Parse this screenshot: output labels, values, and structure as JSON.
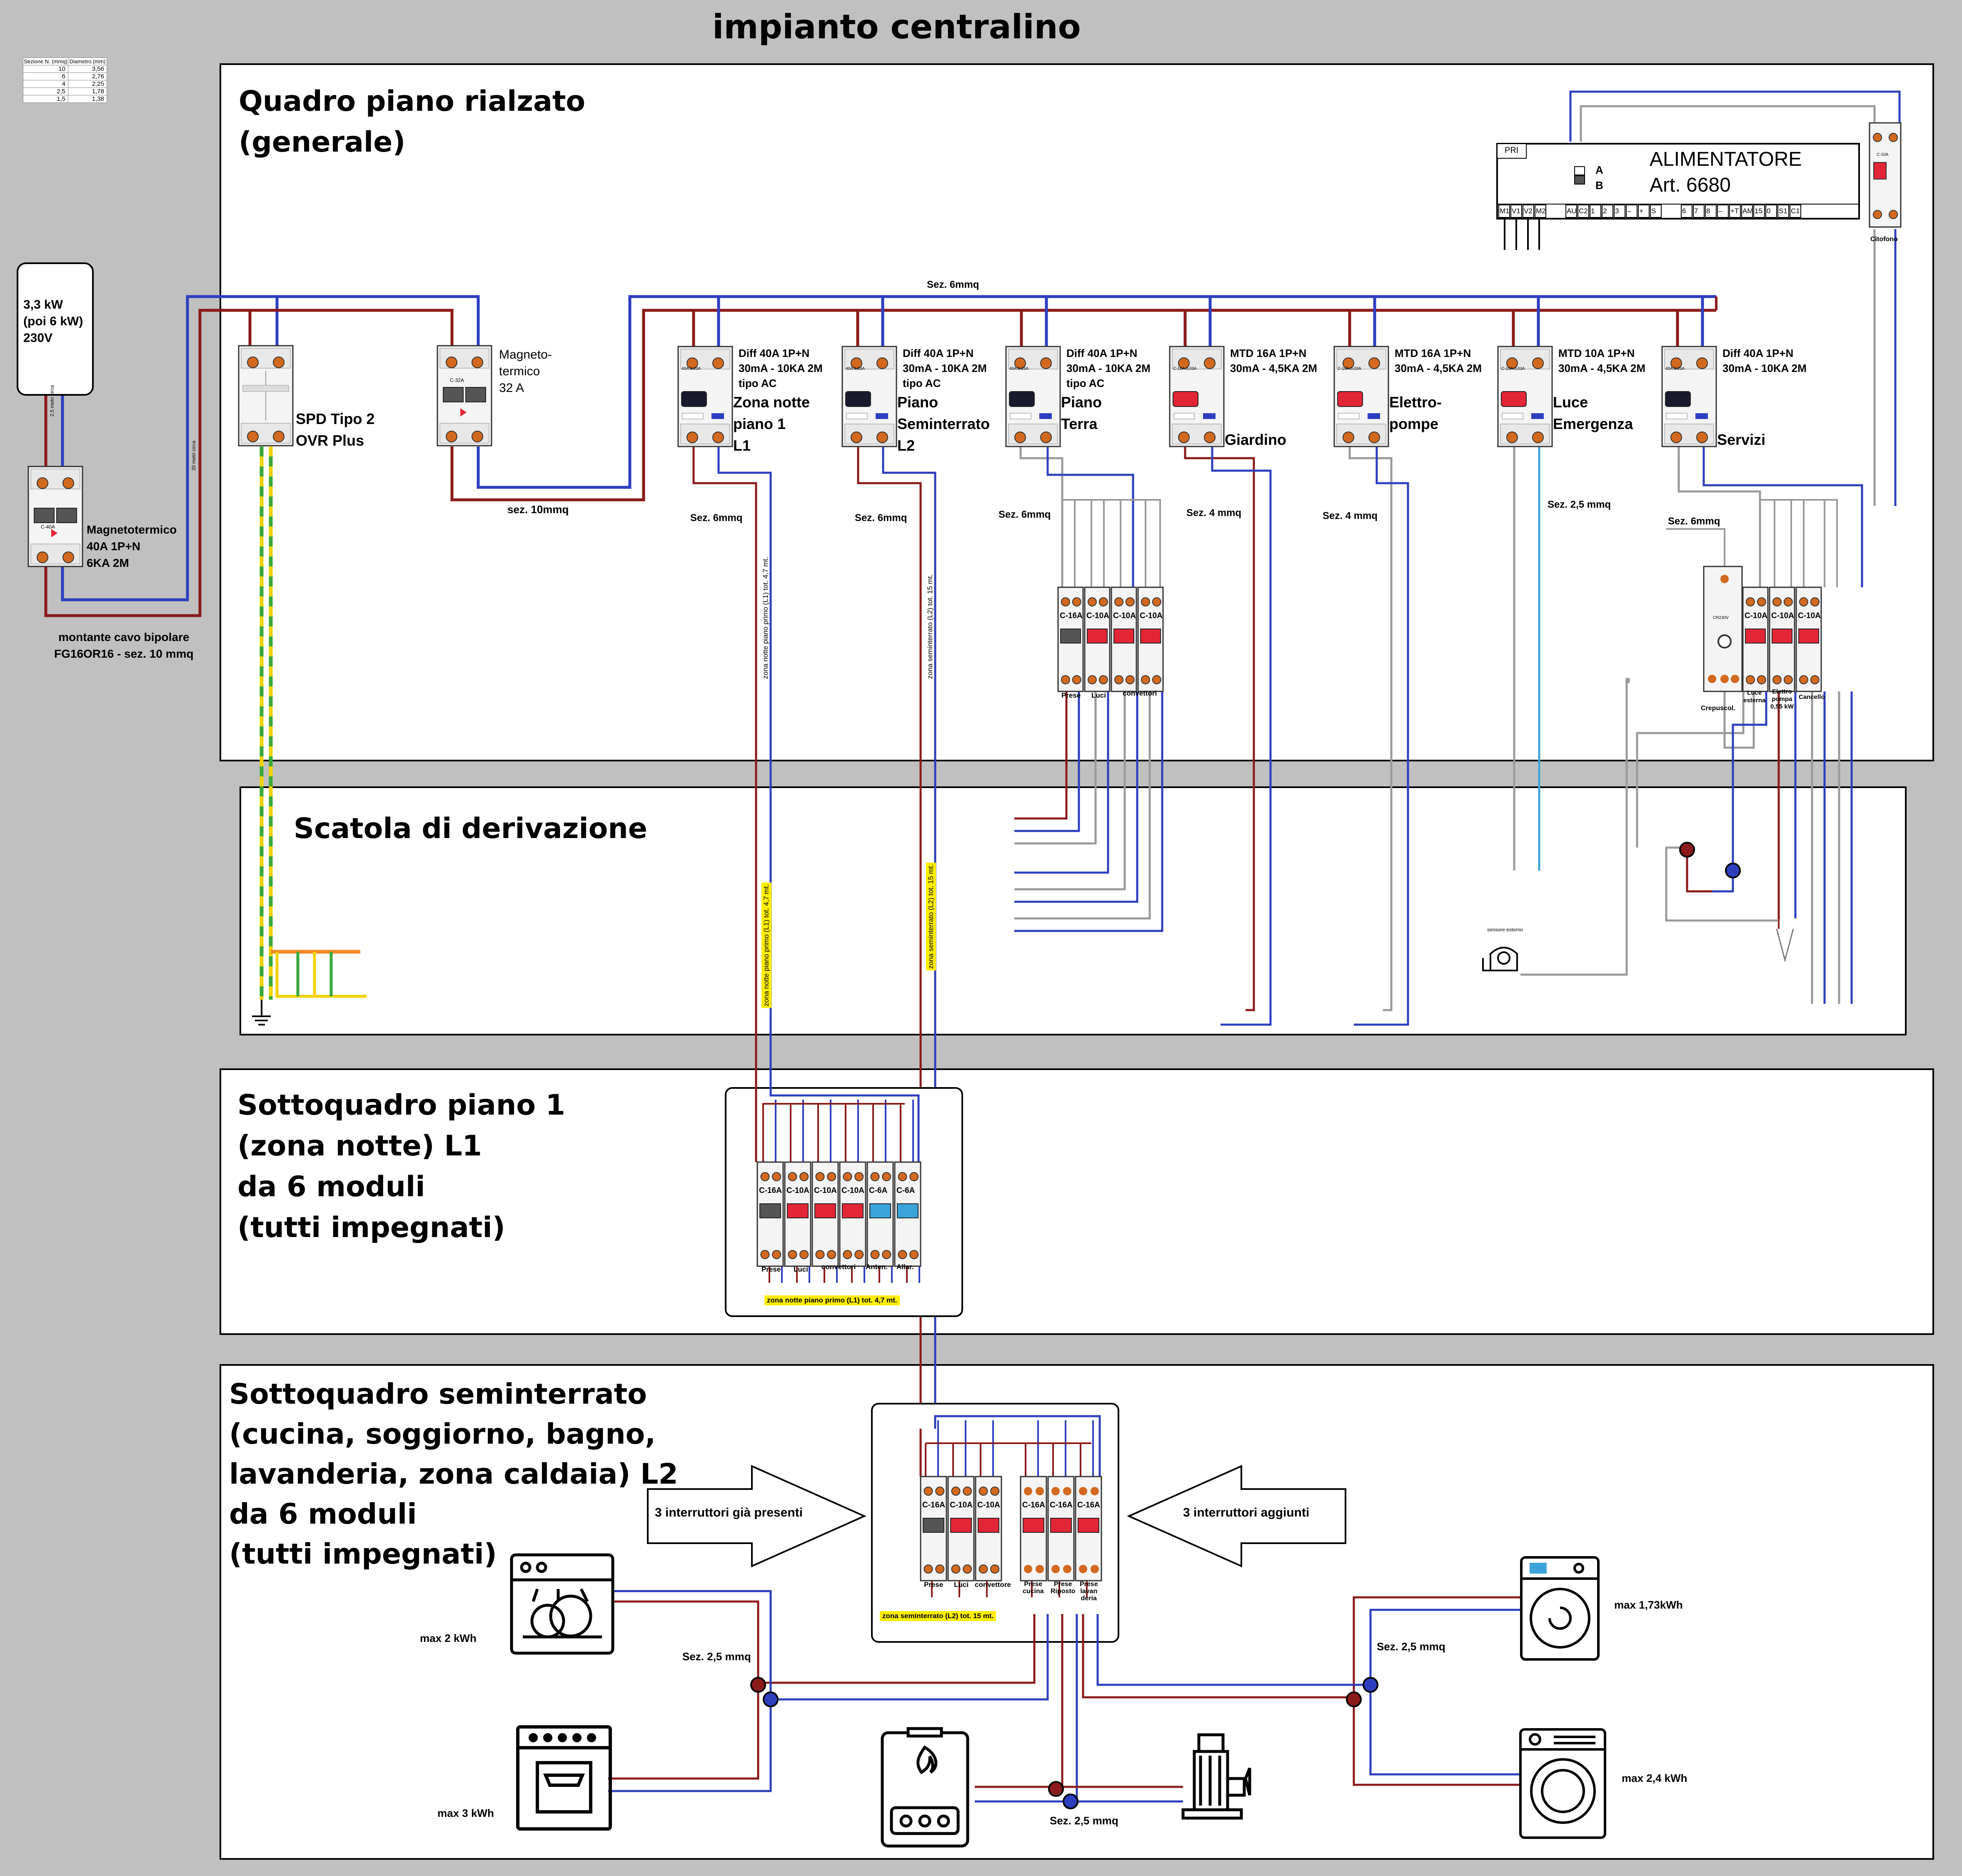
{
  "page_title": "impianto centralino",
  "sections": {
    "quadro": "Quadro piano rialzato\n(generale)",
    "scatola": "Scatola di derivazione",
    "sotto1": "Sottoquadro piano 1\n(zona notte) L1\nda 6 moduli\n(tutti impegnati)",
    "sotto2": "Sottoquadro seminterrato\n(cucina, soggiorno, bagno,\nlavanderia, zona caldaia) L2\nda 6 moduli\n(tutti impegnati)"
  },
  "wire_table": {
    "headers": [
      "Sezione N. (mmq)",
      "Diametro (mm)"
    ],
    "rows": [
      [
        "10",
        "3,56"
      ],
      [
        "6",
        "2,76"
      ],
      [
        "4",
        "2,25"
      ],
      [
        "2,5",
        "1,78"
      ],
      [
        "1,5",
        "1,38"
      ]
    ]
  },
  "meter": {
    "label": "3,3 kW\n(poi 6 kW)\n230V"
  },
  "main_breaker": {
    "rating": "C-40A",
    "label": "Magnetotermico\n40A 1P+N\n6KA 2M"
  },
  "riser_cable": {
    "label": "montante cavo bipolare\nFG16OR16 - sez. 10 mmq",
    "len1": "2,5 metri circa",
    "len2": "20 metri circa"
  },
  "spd": {
    "label": "SPD Tipo 2\nOVR Plus"
  },
  "magneto32": {
    "rating": "C-32A",
    "label": "Magneto-\ntermico\n32 A"
  },
  "bus_label": "Sez. 6mmq",
  "feed_label": "sez. 10mmq",
  "modules": [
    {
      "spec": "Diff 40A 1P+N\n30mA - 10KA 2M\ntipo AC",
      "name": "Zona notte\npiano 1\nL1",
      "handle": "black",
      "rating": "40A 0,03A"
    },
    {
      "spec": "Diff 40A 1P+N\n30mA - 10KA 2M\ntipo AC",
      "name": "Piano\nSeminterrato\nL2",
      "handle": "black",
      "rating": "40A 0,03A"
    },
    {
      "spec": "Diff 40A 1P+N\n30mA - 10KA 2M\ntipo AC",
      "name": "Piano\nTerra",
      "handle": "black",
      "rating": "40A 0,03A"
    },
    {
      "spec": "MTD 16A 1P+N\n30mA - 4,5KA 2M",
      "name": "Giardino",
      "handle": "red",
      "rating": "C-16A 0,03A"
    },
    {
      "spec": "MTD 16A 1P+N\n30mA - 4,5KA 2M",
      "name": "Elettro-\npompe",
      "handle": "red",
      "rating": "C-16A 0,03A"
    },
    {
      "spec": "MTD 10A 1P+N\n30mA - 4,5KA 2M",
      "name": "Luce\nEmergenza",
      "handle": "red",
      "rating": "C-10A 0,03A"
    },
    {
      "spec": "Diff 40A 1P+N\n30mA - 10KA 2M",
      "name": "Servizi",
      "handle": "black",
      "rating": "40A 0,03A"
    }
  ],
  "section_labels": {
    "l1": "Sez. 6mmq",
    "l2": "Sez. 6mmq",
    "pt": "Sez. 6mmq",
    "giardino": "Sez. 4 mmq",
    "pompe": "Sez. 4 mmq",
    "emerg": "Sez. 2,5 mmq",
    "servizi": "Sez. 6mmq"
  },
  "cable_l1": "zona notte piano primo (L1)  tot. 4,7 mt.",
  "cable_l2": "zona seminterrato (L2)  tot. 15 mt.",
  "alimentatore": {
    "title": "ALIMENTATORE\nArt. 6680",
    "pri": "PRI",
    "switch": [
      "A",
      "B"
    ],
    "terminals_left": [
      "M1",
      "V1",
      "V2",
      "M2"
    ],
    "terminals_mid": [
      "AU",
      "C2",
      "1",
      "2",
      "3",
      "–",
      "+",
      "S"
    ],
    "terminals_right": [
      "6",
      "7",
      "8",
      "–",
      "+T",
      "AM",
      "15",
      "0",
      "S1",
      "C1"
    ],
    "citofono_rating": "C-10A",
    "citofono": "Citofono"
  },
  "pt_breakers": {
    "ratings": [
      "C-16A",
      "C-10A",
      "C-10A",
      "C-10A"
    ],
    "labels": [
      "Prese",
      "Luci",
      "convettori"
    ]
  },
  "servizi_breakers": {
    "ratings": [
      "C-10A",
      "C-10A",
      "C-10A"
    ],
    "labels": [
      "Luce\nesterna",
      "Elettro\npompa\n0,55 kW",
      "Cancello"
    ],
    "crepuscolare": "Crepuscol.",
    "crep_model": "CR230V"
  },
  "sensor_label": "sensore esterno",
  "sotto1_breakers": {
    "ratings": [
      "C-16A",
      "C-10A",
      "C-10A",
      "C-10A",
      "C-6A",
      "C-6A"
    ],
    "labels": [
      "Prese",
      "Luci",
      "convettori",
      "Anten.",
      "Allar."
    ]
  },
  "sotto2_breakers": {
    "ratings": [
      "C-16A",
      "C-10A",
      "C-10A",
      "C-16A",
      "C-16A",
      "C-16A"
    ],
    "labels": [
      "Prese",
      "Luci",
      "convettore",
      "Prese\ncucina",
      "Prese\nRiposto",
      "Prese\nlavan\nderia"
    ]
  },
  "arrows": {
    "left": "3 interruttori già presenti",
    "right": "3 interruttori  aggiunti"
  },
  "appliances": {
    "dishwasher": "max 2 kWh",
    "oven": "max 3 kWh",
    "dryer": "max 1,73kWh",
    "washer": "max 2,4 kWh"
  },
  "sez25": "Sez. 2,5 mmq",
  "colors": {
    "phase": "#8b1a1a",
    "neutral": "#2d3fbf",
    "earth_y": "#f2d200",
    "earth_g": "#3aa83a",
    "grey": "#9a9a9a",
    "cyan": "#3aa3d9",
    "orange": "#f08a24"
  }
}
